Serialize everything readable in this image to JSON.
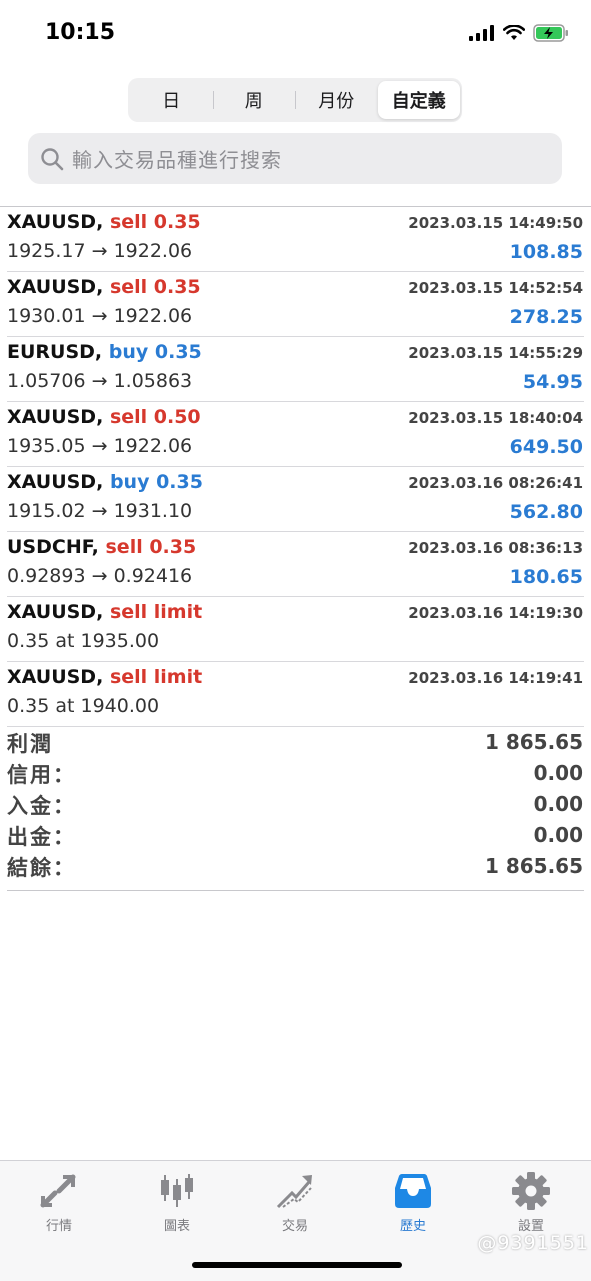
{
  "status": {
    "time": "10:15"
  },
  "period_tabs": [
    {
      "label": "日",
      "active": false
    },
    {
      "label": "周",
      "active": false
    },
    {
      "label": "月份",
      "active": false
    },
    {
      "label": "自定義",
      "active": true
    }
  ],
  "search": {
    "placeholder": "輸入交易品種進行搜索"
  },
  "trades": [
    {
      "symbol": "XAUUSD,",
      "side": "sell 0.35",
      "type": "sell",
      "time": "2023.03.15 14:49:50",
      "price": "1925.17 → 1922.06",
      "profit": "108.85"
    },
    {
      "symbol": "XAUUSD,",
      "side": "sell 0.35",
      "type": "sell",
      "time": "2023.03.15 14:52:54",
      "price": "1930.01 → 1922.06",
      "profit": "278.25"
    },
    {
      "symbol": "EURUSD,",
      "side": "buy 0.35",
      "type": "buy",
      "time": "2023.03.15 14:55:29",
      "price": "1.05706 → 1.05863",
      "profit": "54.95"
    },
    {
      "symbol": "XAUUSD,",
      "side": "sell 0.50",
      "type": "sell",
      "time": "2023.03.15 18:40:04",
      "price": "1935.05 → 1922.06",
      "profit": "649.50"
    },
    {
      "symbol": "XAUUSD,",
      "side": "buy 0.35",
      "type": "buy",
      "time": "2023.03.16 08:26:41",
      "price": "1915.02 → 1931.10",
      "profit": "562.80"
    },
    {
      "symbol": "USDCHF,",
      "side": "sell 0.35",
      "type": "sell",
      "time": "2023.03.16 08:36:13",
      "price": "0.92893 → 0.92416",
      "profit": "180.65"
    },
    {
      "symbol": "XAUUSD,",
      "side": "sell limit",
      "type": "sell",
      "time": "2023.03.16 14:19:30",
      "price": "0.35 at 1935.00",
      "profit": ""
    },
    {
      "symbol": "XAUUSD,",
      "side": "sell limit",
      "type": "sell",
      "time": "2023.03.16 14:19:41",
      "price": "0.35 at 1940.00",
      "profit": ""
    }
  ],
  "summary": [
    {
      "label": "利潤",
      "value": "1 865.65"
    },
    {
      "label": "信用：",
      "value": "0.00"
    },
    {
      "label": "入金：",
      "value": "0.00"
    },
    {
      "label": "出金：",
      "value": "0.00"
    },
    {
      "label": "結餘：",
      "value": "1 865.65"
    }
  ],
  "tab_bar": [
    {
      "label": "行情",
      "icon": "quotes-arrows-icon",
      "active": false
    },
    {
      "label": "圖表",
      "icon": "candlestick-chart-icon",
      "active": false
    },
    {
      "label": "交易",
      "icon": "trade-trend-icon",
      "active": false
    },
    {
      "label": "歷史",
      "icon": "history-tray-icon",
      "active": true
    },
    {
      "label": "設置",
      "icon": "gear-icon",
      "active": false
    }
  ],
  "watermark": "@9391551",
  "colors": {
    "sell": "#d6382d",
    "buy": "#2a7bd2",
    "active_tab": "#2a7bd2",
    "battery": "#34c759"
  }
}
